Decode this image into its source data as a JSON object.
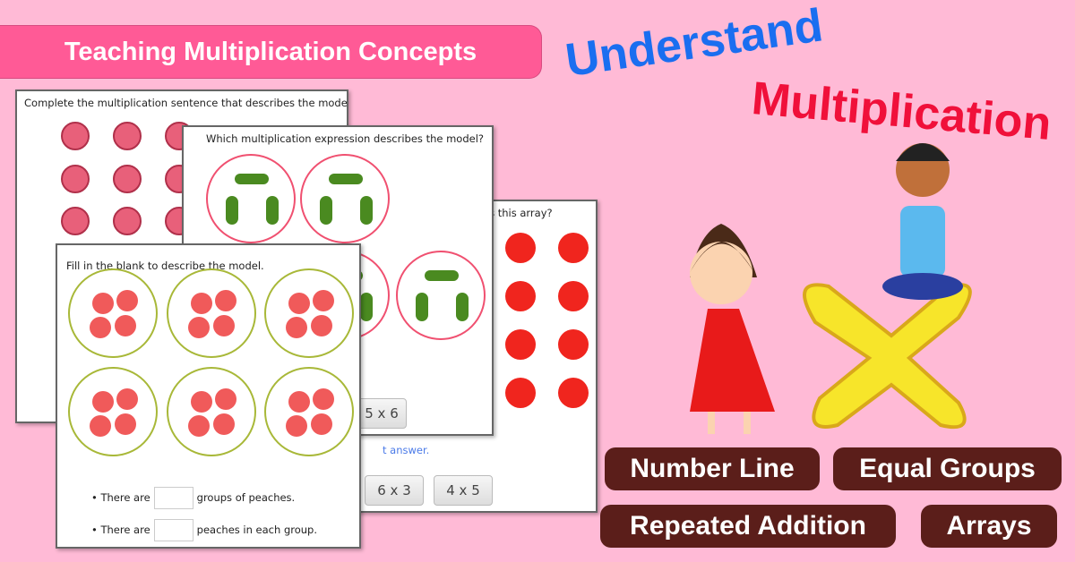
{
  "banner": {
    "title": "Teaching Multiplication Concepts",
    "color": "#ff5a96"
  },
  "headline": {
    "line1": "Understand",
    "line2": "Multiplication",
    "line1_color": "#1a6ef0",
    "line2_color": "#f0103a"
  },
  "card_meat": {
    "question": "Complete the multiplication sentence that describes the model."
  },
  "card_candy": {
    "question": "Which multiplication expression describes the model?",
    "option": "5 x 6"
  },
  "card_apples": {
    "question_fragment": "es this array?",
    "hint_fragment": "t answer.",
    "options": [
      "6 x 3",
      "4 x 5"
    ]
  },
  "card_peach": {
    "question": "Fill in the blank to describe the model.",
    "line1_pre": "There are",
    "line1_post": "groups of peaches.",
    "line2_pre": "There are",
    "line2_post": "peaches in each group."
  },
  "topics": [
    "Number Line",
    "Equal Groups",
    "Repeated Addition",
    "Arrays"
  ],
  "colors": {
    "background": "#ffbad6",
    "pill": "#5b1e1a",
    "x_symbol": "#f7e52a"
  }
}
